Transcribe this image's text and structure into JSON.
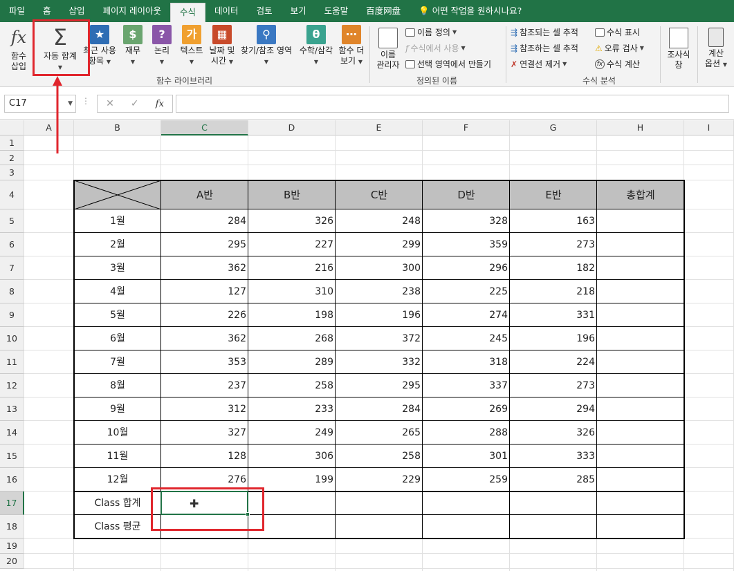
{
  "tabs": [
    "파일",
    "홈",
    "삽입",
    "페이지 레이아웃",
    "수식",
    "데이터",
    "검토",
    "보기",
    "도움말",
    "百度网盘"
  ],
  "active_tab": "수식",
  "tell_me": "어떤 작업을 원하시나요?",
  "ribbon": {
    "insert_function": [
      "함수",
      "삽입"
    ],
    "autosum": "자동 합계",
    "recent": [
      "최근 사용",
      "항목"
    ],
    "financial": "재무",
    "logical": "논리",
    "text": "텍스트",
    "datetime": [
      "날짜 및",
      "시간"
    ],
    "lookup": "찾기/참조 영역",
    "math": "수학/삼각",
    "more": [
      "함수 더",
      "보기"
    ],
    "library_label": "함수 라이브러리",
    "name_manager": [
      "이름",
      "관리자"
    ],
    "define_name": "이름 정의",
    "use_in_formula": "수식에서 사용",
    "create_from_selection": "선택 영역에서 만들기",
    "defined_names_label": "정의된 이름",
    "trace_precedents": "참조되는 셀 추적",
    "trace_dependents": "참조하는 셀 추적",
    "remove_arrows": "연결선 제거",
    "show_formulas": "수식 표시",
    "error_checking": "오류 검사",
    "evaluate_formula": "수식 계산",
    "formula_auditing_label": "수식 분석",
    "watch_window": [
      "조사식",
      "창"
    ],
    "calc_options": [
      "계산",
      "옵션"
    ],
    "cancel_icon": "✕",
    "enter_icon": "✓",
    "fx_icon": "fx"
  },
  "formula_bar": {
    "name_box": "C17",
    "formula": ""
  },
  "columns": [
    "A",
    "B",
    "C",
    "D",
    "E",
    "F",
    "G",
    "H",
    "I"
  ],
  "rows": [
    "1",
    "2",
    "3",
    "4",
    "5",
    "6",
    "7",
    "8",
    "9",
    "10",
    "11",
    "12",
    "13",
    "14",
    "15",
    "16",
    "17",
    "18",
    "19",
    "20"
  ],
  "table": {
    "headers": [
      "A반",
      "B반",
      "C반",
      "D반",
      "E반",
      "총합계"
    ],
    "months": [
      "1월",
      "2월",
      "3월",
      "4월",
      "5월",
      "6월",
      "7월",
      "8월",
      "9월",
      "10월",
      "11월",
      "12월"
    ],
    "values": [
      [
        284,
        326,
        248,
        328,
        163
      ],
      [
        295,
        227,
        299,
        359,
        273
      ],
      [
        362,
        216,
        300,
        296,
        182
      ],
      [
        127,
        310,
        238,
        225,
        218
      ],
      [
        226,
        198,
        196,
        274,
        331
      ],
      [
        362,
        268,
        372,
        245,
        196
      ],
      [
        353,
        289,
        332,
        318,
        224
      ],
      [
        237,
        258,
        295,
        337,
        273
      ],
      [
        312,
        233,
        284,
        269,
        294
      ],
      [
        327,
        249,
        265,
        288,
        326
      ],
      [
        128,
        306,
        258,
        301,
        333
      ],
      [
        276,
        199,
        229,
        259,
        285
      ]
    ],
    "sum_label": "Class 합계",
    "avg_label": "Class 평균"
  },
  "colors": {
    "accent": "#217346",
    "highlight": "#e0262d",
    "header_fill": "#c0c0c0"
  }
}
